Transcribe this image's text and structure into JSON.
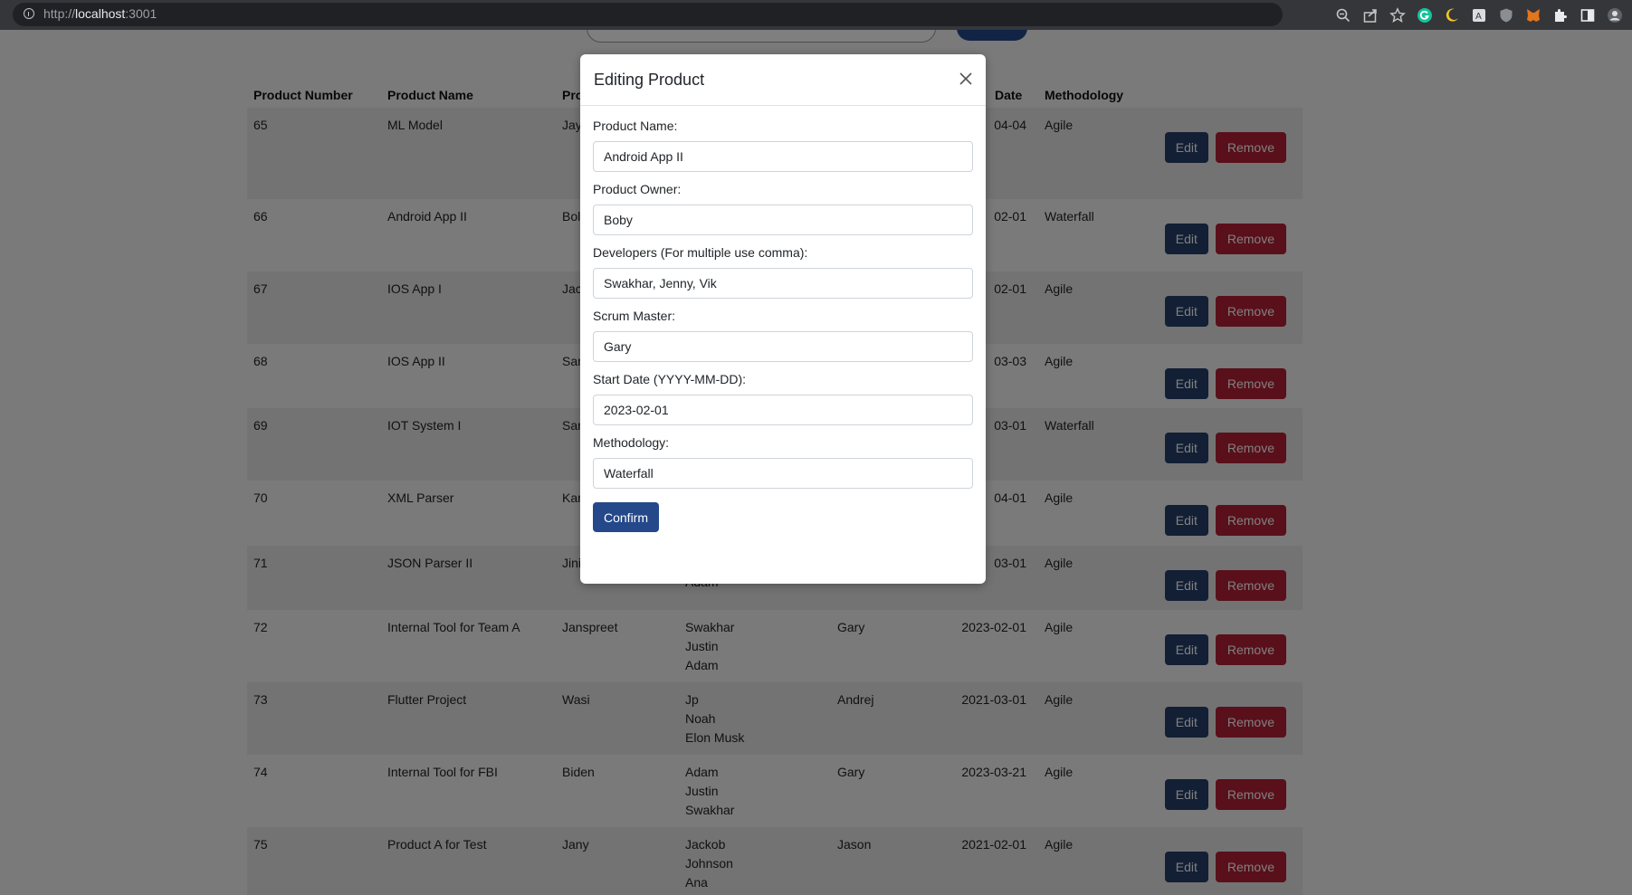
{
  "browser": {
    "url_scheme": "http://",
    "url_host": "localhost",
    "url_port": ":3001"
  },
  "table": {
    "headers": [
      "Product Number",
      "Product Name",
      "Pro",
      "",
      "",
      "Date",
      "Methodology",
      ""
    ],
    "rows": [
      {
        "num": "65",
        "name": "ML Model",
        "owner": "Jay",
        "devs": [],
        "scrum": "",
        "date": "04-04",
        "method": "Agile"
      },
      {
        "num": "66",
        "name": "Android App II",
        "owner": "Bol",
        "devs": [],
        "scrum": "",
        "date": "02-01",
        "method": "Waterfall"
      },
      {
        "num": "67",
        "name": "IOS App I",
        "owner": "Jac",
        "devs": [],
        "scrum": "",
        "date": "02-01",
        "method": "Agile"
      },
      {
        "num": "68",
        "name": "IOS App II",
        "owner": "Sar",
        "devs": [],
        "scrum": "",
        "date": "03-03",
        "method": "Agile"
      },
      {
        "num": "69",
        "name": "IOT System I",
        "owner": "Sar",
        "devs": [],
        "scrum": "",
        "date": "03-01",
        "method": "Waterfall"
      },
      {
        "num": "70",
        "name": "XML Parser",
        "owner": "Kar",
        "devs": [],
        "scrum": "",
        "date": "04-01",
        "method": "Agile"
      },
      {
        "num": "71",
        "name": "JSON Parser II",
        "owner": "Jini",
        "devs": [
          "",
          "Adam"
        ],
        "scrum": "",
        "date": "03-01",
        "method": "Agile"
      },
      {
        "num": "72",
        "name": "Internal Tool for Team A",
        "owner": "Janspreet",
        "devs": [
          "Swakhar",
          "Justin",
          "Adam"
        ],
        "scrum": "Gary",
        "date": "2023-02-01",
        "method": "Agile"
      },
      {
        "num": "73",
        "name": "Flutter Project",
        "owner": "Wasi",
        "devs": [
          "Jp",
          "Noah",
          "Elon Musk"
        ],
        "scrum": "Andrej",
        "date": "2021-03-01",
        "method": "Agile"
      },
      {
        "num": "74",
        "name": "Internal Tool for FBI",
        "owner": "Biden",
        "devs": [
          "Adam",
          "Justin",
          "Swakhar"
        ],
        "scrum": "Gary",
        "date": "2023-03-21",
        "method": "Agile"
      },
      {
        "num": "75",
        "name": "Product A for Test",
        "owner": "Jany",
        "devs": [
          "Jackob",
          "Johnson",
          "Ana"
        ],
        "scrum": "Jason",
        "date": "2021-02-01",
        "method": "Agile"
      }
    ],
    "edit_label": "Edit",
    "remove_label": "Remove"
  },
  "modal": {
    "title": "Editing Product",
    "fields": [
      {
        "label": "Product Name:",
        "value": "Android App II"
      },
      {
        "label": "Product Owner:",
        "value": "Boby"
      },
      {
        "label": "Developers (For multiple use comma):",
        "value": "Swakhar, Jenny, Vik"
      },
      {
        "label": "Scrum Master:",
        "value": "Gary"
      },
      {
        "label": "Start Date (YYYY-MM-DD):",
        "value": "2023-02-01"
      },
      {
        "label": "Methodology:",
        "value": "Waterfall"
      }
    ],
    "confirm_label": "Confirm"
  },
  "colors": {
    "primary": "#24488a",
    "edit": "#243e6b",
    "remove": "#b32137"
  }
}
